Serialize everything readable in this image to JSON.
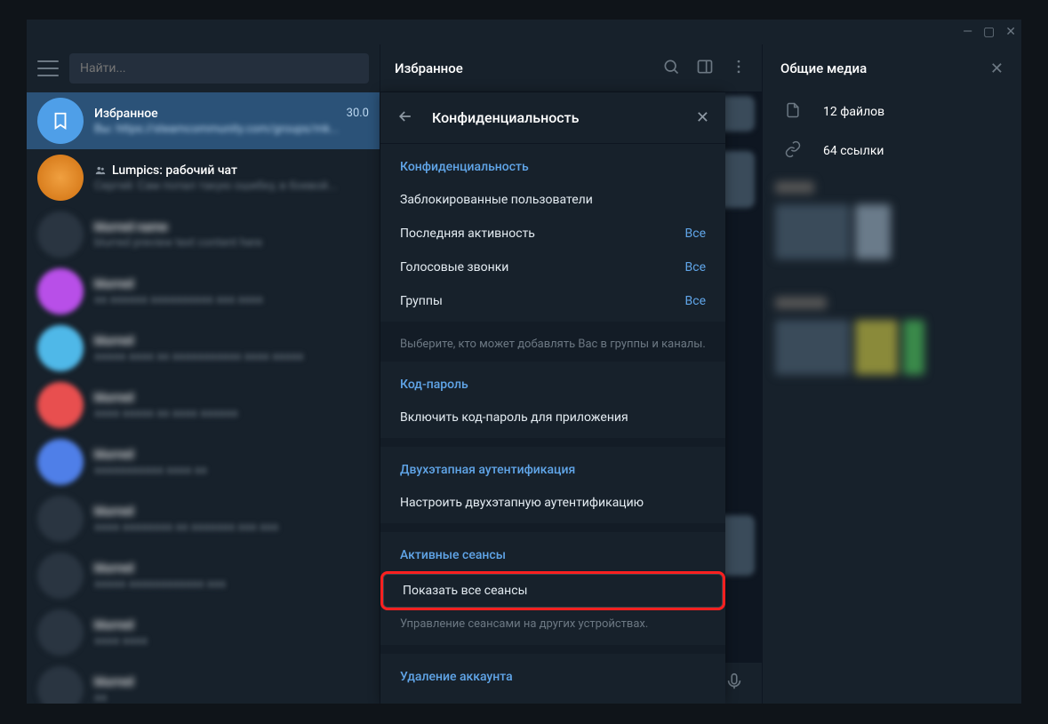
{
  "search": {
    "placeholder": "Найти..."
  },
  "chats": [
    {
      "title": "Избранное",
      "date": "30.0",
      "preview": "Вы: https://steamcommunity.com/groups/mk...",
      "selected": true,
      "icon": "bookmark",
      "color": "#4f9fe8"
    },
    {
      "title": "Lumpics: рабочий чат",
      "date": "",
      "preview": "Сергей: Сам попал такую ошибку, в боевой...",
      "icon": "group",
      "color": "#e8a04f",
      "img": true
    },
    {
      "title": "blurred name",
      "preview": "blurred preview text content here",
      "blurred": true,
      "color": "#2a3541"
    },
    {
      "title": "blurred",
      "preview": "aa aaaaaa aaaaaaaaaa aaa aaaa",
      "blurred": true,
      "color": "#b84fe8"
    },
    {
      "title": "blurred",
      "preview": "aaaaa aaaa aa aaaaaaaaaaa aaaa aaaaa",
      "blurred": true,
      "color": "#4fb8e8"
    },
    {
      "title": "blurred",
      "preview": "aaaa aaaaa aa aaaa aaaaaa",
      "blurred": true,
      "color": "#e84f4f"
    },
    {
      "title": "blurred",
      "preview": "aaaaaaaaaaa aaaa aa",
      "blurred": true,
      "color": "#4f7fe8"
    },
    {
      "title": "blurred",
      "preview": "aaaa aaaaaaaa aa aaaaaaa aaa aaa",
      "blurred": true,
      "color": "#2a3541"
    },
    {
      "title": "blurred",
      "preview": "aaaaa aaaaaaaaaaaa aaa",
      "blurred": true,
      "color": "#2a3541"
    },
    {
      "title": "blurred",
      "preview": "aaaa aaaa",
      "blurred": true,
      "color": "#2a3541"
    },
    {
      "title": "blurred",
      "preview": "aa",
      "blurred": true,
      "color": "#2a3541"
    }
  ],
  "chatHeader": {
    "title": "Избранное"
  },
  "rightPanel": {
    "title": "Общие медиа",
    "files": "12 файлов",
    "links": "64 ссылки"
  },
  "settings": {
    "title": "Конфиденциальность",
    "privacy": {
      "header": "Конфиденциальность",
      "blocked": "Заблокированные пользователи",
      "lastActivity": {
        "label": "Последняя активность",
        "value": "Все"
      },
      "calls": {
        "label": "Голосовые звонки",
        "value": "Все"
      },
      "groups": {
        "label": "Группы",
        "value": "Все"
      },
      "desc": "Выберите, кто может добавлять Вас в группы и каналы."
    },
    "passcode": {
      "header": "Код-пароль",
      "enable": "Включить код-пароль для приложения"
    },
    "twofa": {
      "header": "Двухэтапная аутентификация",
      "setup": "Настроить двухэтапную аутентификацию"
    },
    "sessions": {
      "header": "Активные сеансы",
      "showAll": "Показать все сеансы",
      "desc": "Управление сеансами на других устройствах."
    },
    "deletion": {
      "header": "Удаление аккаунта"
    }
  }
}
